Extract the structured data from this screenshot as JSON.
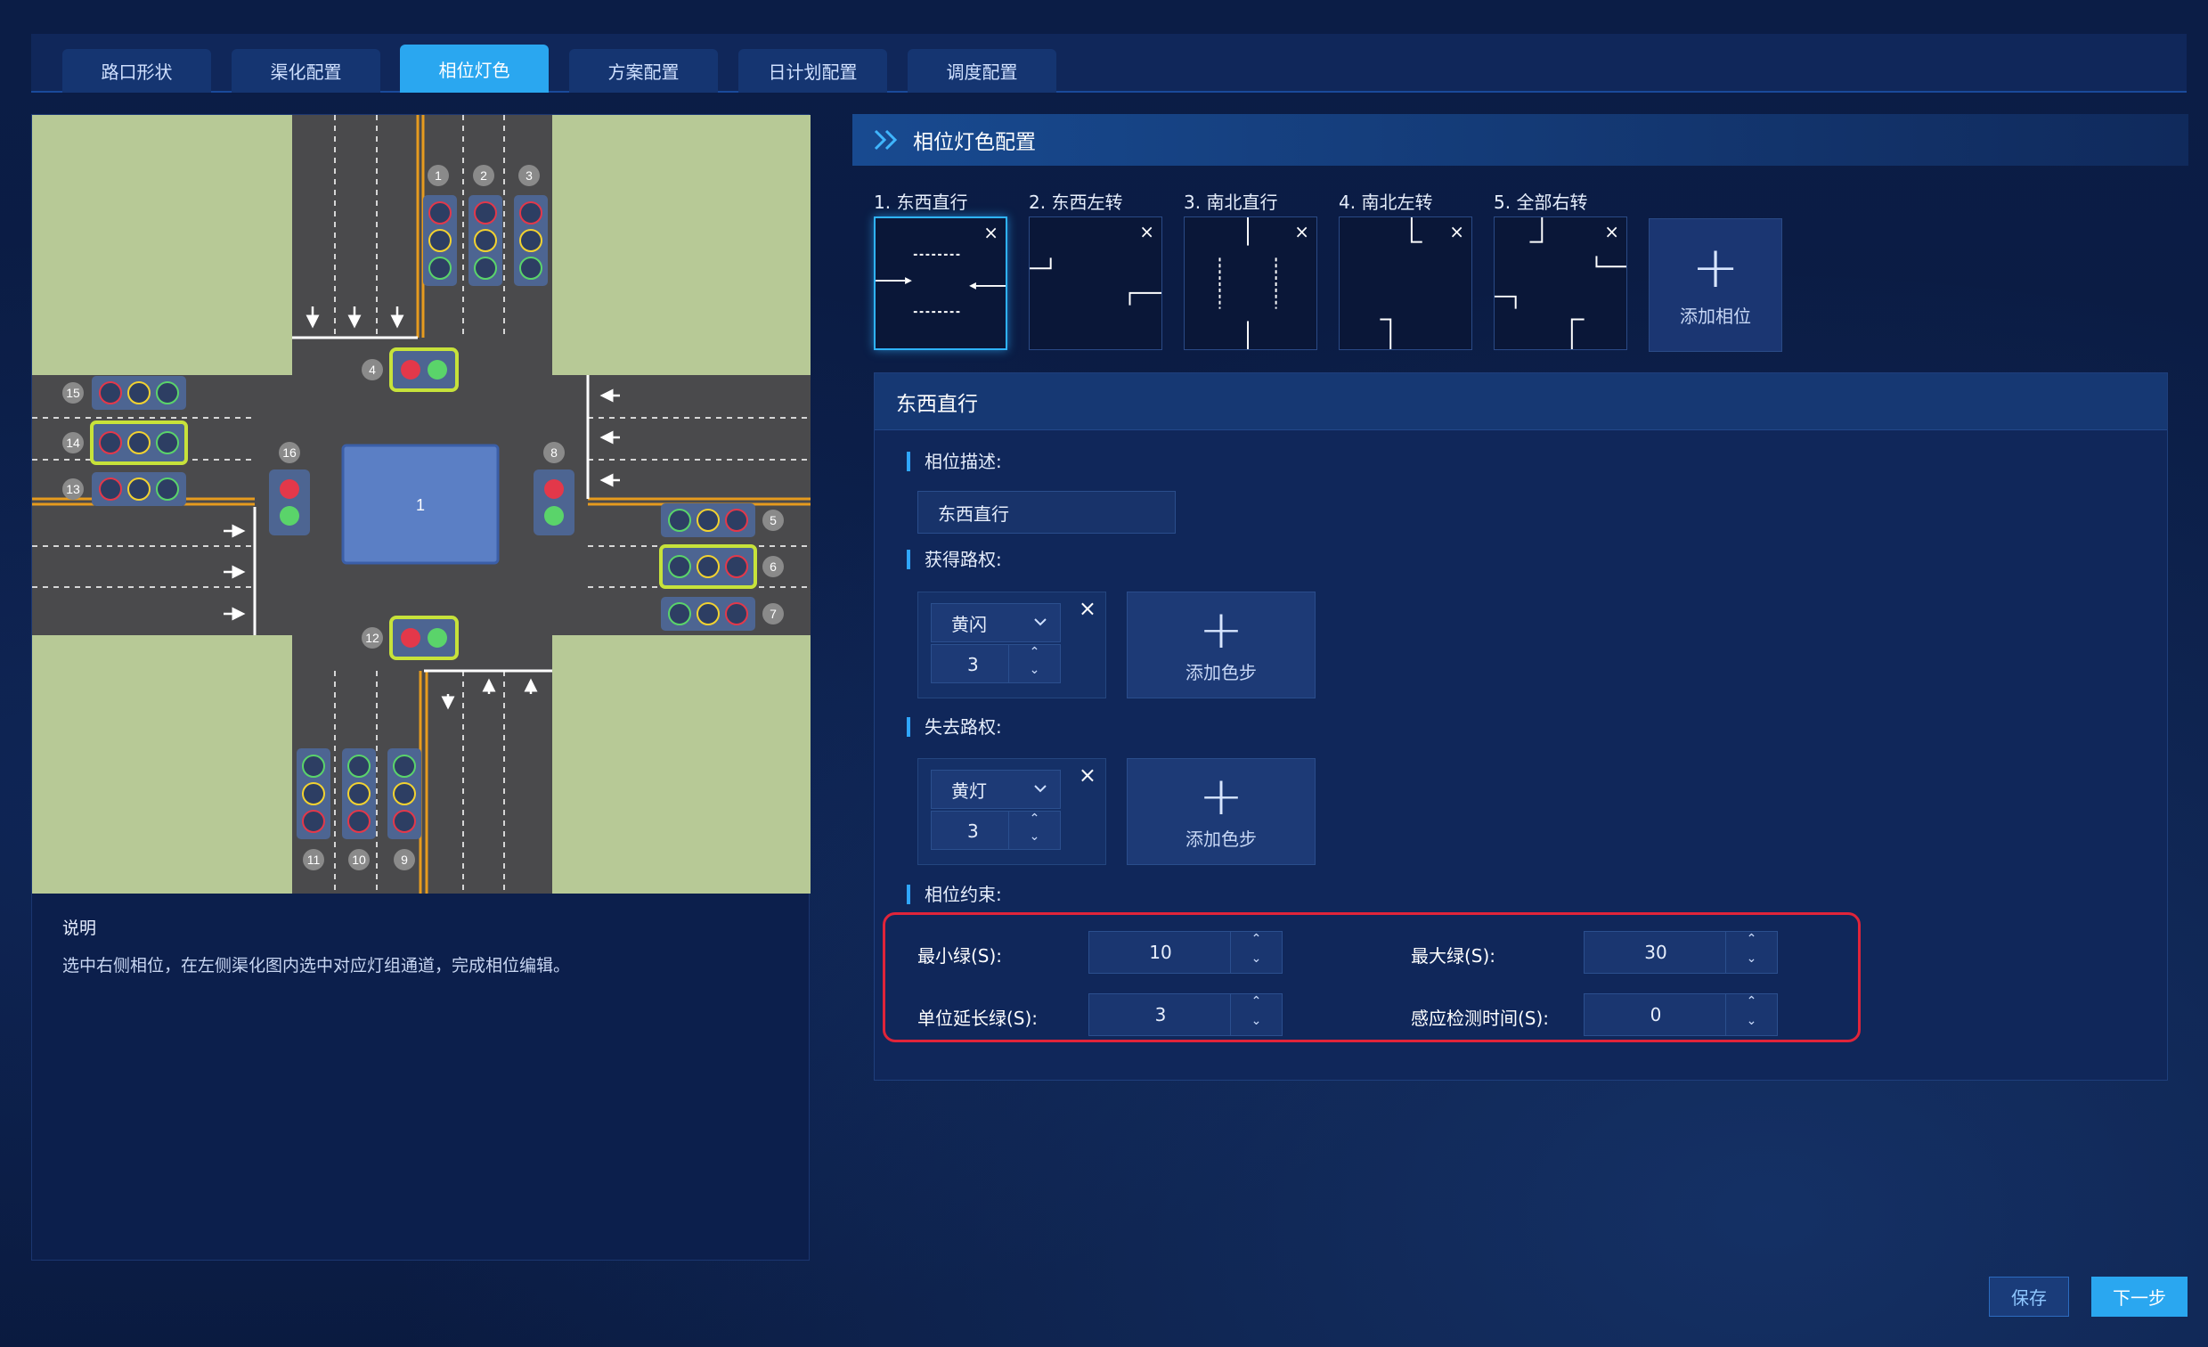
{
  "tabs": [
    "路口形状",
    "渠化配置",
    "相位灯色",
    "方案配置",
    "日计划配置",
    "调度配置"
  ],
  "active_tab": "相位灯色",
  "left": {
    "intersection_label": "1",
    "signal_numbers": [
      "1",
      "2",
      "3",
      "4",
      "5",
      "6",
      "7",
      "8",
      "9",
      "10",
      "11",
      "12",
      "13",
      "14",
      "15",
      "16"
    ],
    "description_title": "说明",
    "description_text": "选中右侧相位，在左侧渠化图内选中对应灯组通道，完成相位编辑。"
  },
  "right": {
    "header_title": "相位灯色配置",
    "phases": [
      {
        "label": "1. 东西直行",
        "close": "×"
      },
      {
        "label": "2. 东西左转",
        "close": "×"
      },
      {
        "label": "3. 南北直行",
        "close": "×"
      },
      {
        "label": "4. 南北左转",
        "close": "×"
      },
      {
        "label": "5. 全部右转",
        "close": "×"
      }
    ],
    "add_phase_label": "添加相位",
    "detail": {
      "title": "东西直行",
      "desc_label": "相位描述:",
      "desc_value": "东西直行",
      "gain_label": "获得路权:",
      "gain_step": {
        "color": "黄闪",
        "value": "3"
      },
      "lose_label": "失去路权:",
      "lose_step": {
        "color": "黄灯",
        "value": "3"
      },
      "add_step_label": "添加色步",
      "constraint_label": "相位约束:",
      "constraints": {
        "min_green_label": "最小绿(S):",
        "min_green": "10",
        "max_green_label": "最大绿(S):",
        "max_green": "30",
        "unit_ext_label": "单位延长绿(S):",
        "unit_ext": "3",
        "detect_label": "感应检测时间(S):",
        "detect": "0"
      }
    }
  },
  "buttons": {
    "save": "保存",
    "next": "下一步"
  },
  "colors": {
    "accent": "#2aa7f0",
    "highlight": "#e0243a",
    "signal_select": "#c7e23a"
  }
}
